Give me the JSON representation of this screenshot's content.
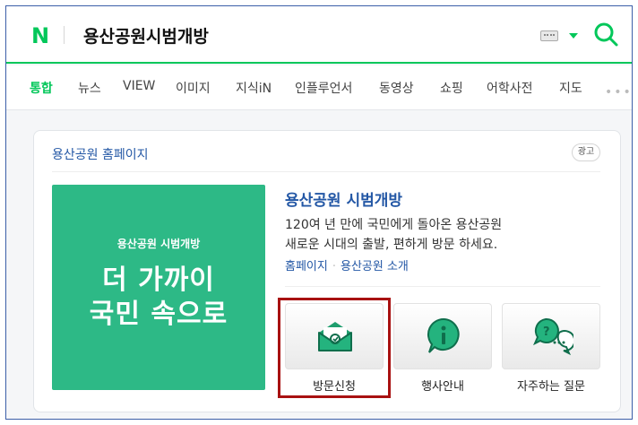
{
  "header": {
    "logo": "N",
    "query": "용산공원시범개방",
    "icons": [
      "keyboard-icon",
      "dropdown-arrow-icon",
      "search-icon"
    ],
    "brand_color": "#03c75a"
  },
  "tabs": [
    {
      "label": "통합",
      "active": true
    },
    {
      "label": "뉴스"
    },
    {
      "label": "VIEW"
    },
    {
      "label": "이미지"
    },
    {
      "label": "지식iN"
    },
    {
      "label": "인플루언서"
    },
    {
      "label": "동영상"
    },
    {
      "label": "쇼핑"
    },
    {
      "label": "어학사전"
    },
    {
      "label": "지도"
    }
  ],
  "ad": {
    "site_name": "용산공원",
    "site_sub": "홈페이지",
    "badge": "광고",
    "banner": {
      "subtitle": "용산공원 시범개방",
      "line1": "더 가까이",
      "line2": "국민 속으로",
      "color": "#2db986"
    },
    "title": "용산공원 시범개방",
    "desc_line1": "120여 년 만에 국민에게 돌아온 용산공원",
    "desc_line2": "새로운 시대의 출발, 편하게 방문 하세요.",
    "link1": "홈페이지",
    "link2": "용산공원 소개",
    "tiles": [
      {
        "label": "방문신청",
        "icon": "envelope-icon"
      },
      {
        "label": "행사안내",
        "icon": "info-icon"
      },
      {
        "label": "자주하는 질문",
        "icon": "chat-question-icon"
      }
    ]
  }
}
